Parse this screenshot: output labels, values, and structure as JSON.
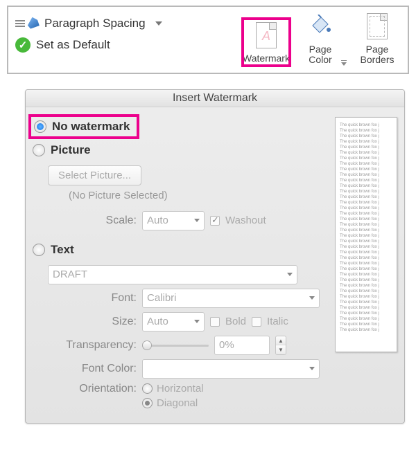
{
  "ribbon": {
    "paragraph_spacing_label": "Paragraph Spacing",
    "set_as_default_label": "Set as Default",
    "watermark_label": "Watermark",
    "page_color_label": "Page Color",
    "page_borders_label": "Page Borders"
  },
  "dialog": {
    "title": "Insert Watermark",
    "no_watermark_label": "No watermark",
    "picture_label": "Picture",
    "select_picture_button": "Select Picture...",
    "no_picture_selected": "(No Picture Selected)",
    "scale_label": "Scale:",
    "scale_value": "Auto",
    "washout_label": "Washout",
    "text_label": "Text",
    "text_value": "DRAFT",
    "font_label": "Font:",
    "font_value": "Calibri",
    "size_label": "Size:",
    "size_value": "Auto",
    "bold_label": "Bold",
    "italic_label": "Italic",
    "transparency_label": "Transparency:",
    "transparency_value": "0%",
    "font_color_label": "Font Color:",
    "orientation_label": "Orientation:",
    "orientation_horizontal": "Horizontal",
    "orientation_diagonal": "Diagonal",
    "preview_line_text": "The quick brown fox j"
  }
}
